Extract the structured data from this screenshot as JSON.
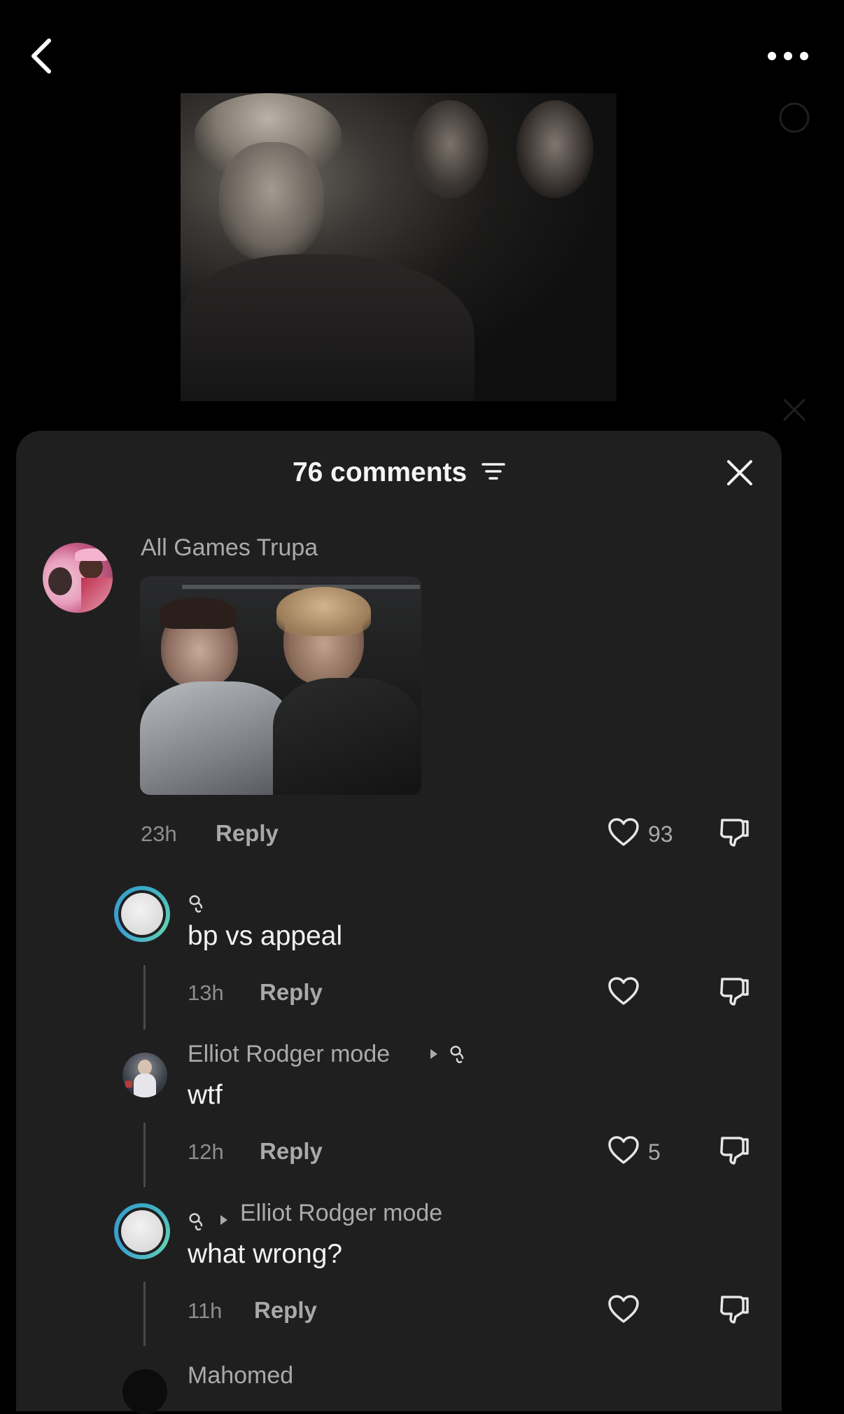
{
  "header": {
    "back_icon": "chevron-left-icon",
    "more_icon": "more-dots-icon"
  },
  "video": {
    "description_icon": "video-thumbnail"
  },
  "sheet": {
    "title": "76 comments",
    "filter_icon": "filter-icon",
    "close_icon": "close-icon"
  },
  "comments": [
    {
      "author": "All Games Trupa",
      "has_image": true,
      "time": "23h",
      "reply_label": "Reply",
      "likes": "93"
    },
    {
      "author_badge": "badge-icon",
      "text": "bp vs appeal",
      "time": "13h",
      "reply_label": "Reply",
      "likes": ""
    },
    {
      "author": "Elliot Rodger mode",
      "text": "wtf",
      "time": "12h",
      "reply_label": "Reply",
      "likes": "5"
    },
    {
      "reply_to": "Elliot Rodger mode",
      "text": "what wrong?",
      "time": "11h",
      "reply_label": "Reply",
      "likes": ""
    },
    {
      "author": "Mahomed"
    }
  ],
  "colors": {
    "background": "#000000",
    "sheet": "#1f1f20",
    "text_primary": "#f2f2f2",
    "text_secondary": "#aaaaac",
    "ring_accent": "#3aa6c7"
  }
}
